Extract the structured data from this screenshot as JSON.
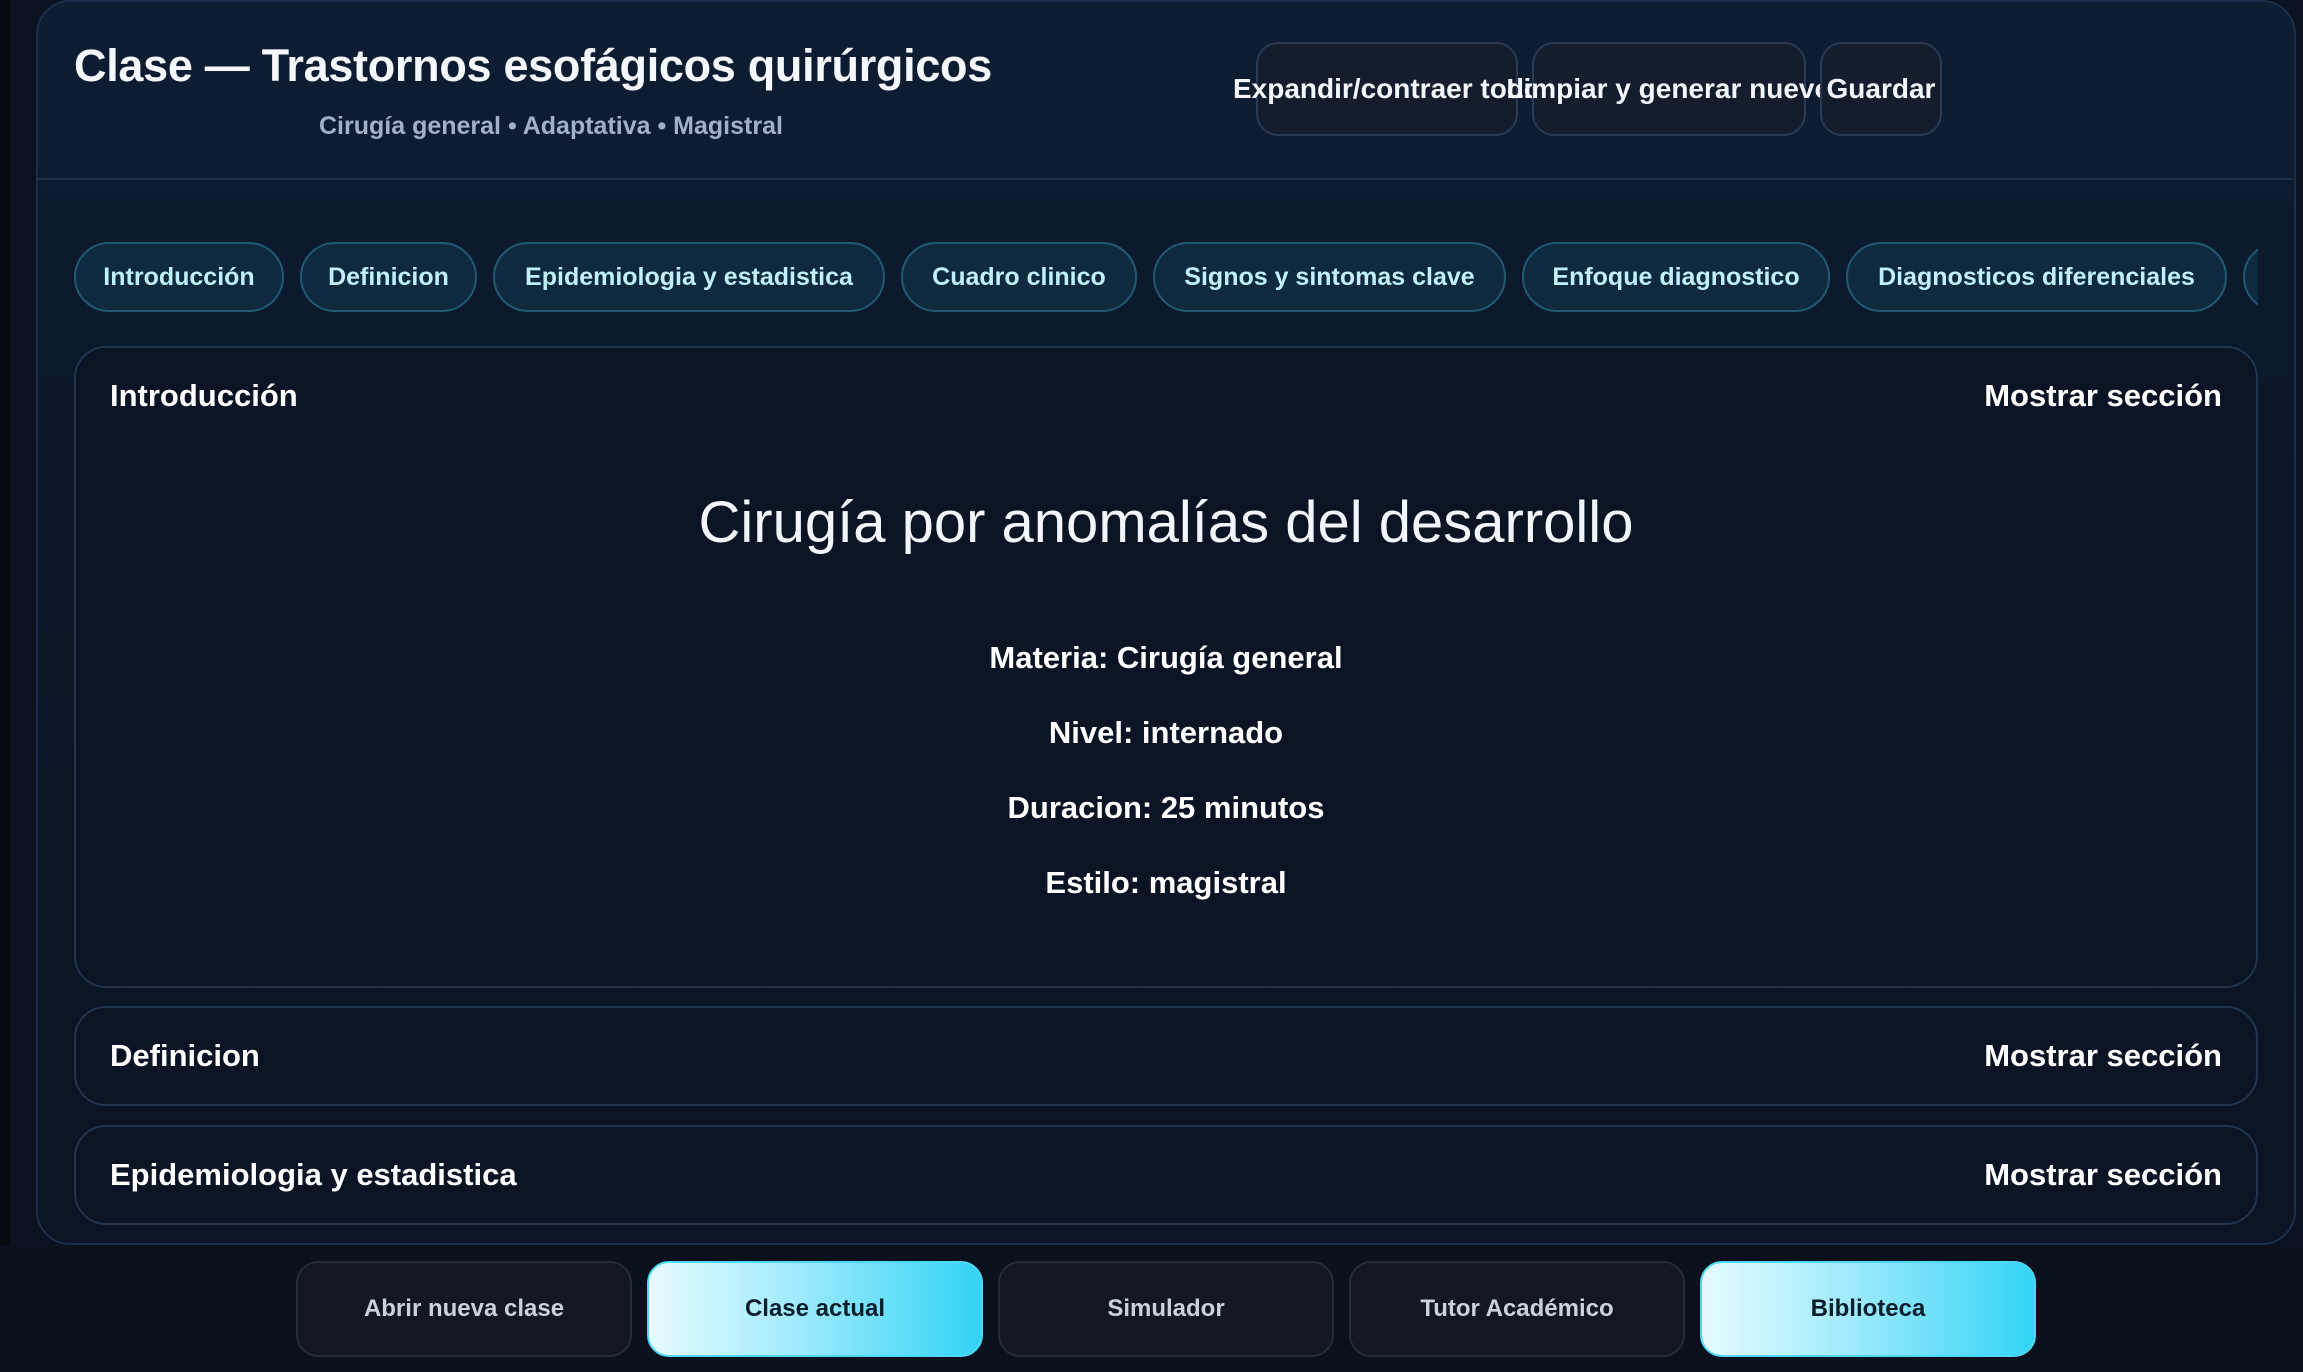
{
  "header": {
    "title": "Clase — Trastornos esofágicos quirúrgicos",
    "subtitle": "Cirugía general • Adaptativa • Magistral",
    "buttons": {
      "expand": "Expandir/contraer todo",
      "clear": "Limpiar y generar nuevo",
      "save": "Guardar"
    }
  },
  "tabs": [
    "Introducción",
    "Definicion",
    "Epidemiologia y estadistica",
    "Cuadro clinico",
    "Signos y sintomas clave",
    "Enfoque diagnostico",
    "Diagnosticos diferenciales"
  ],
  "sections": [
    {
      "title": "Introducción",
      "toggle": "Mostrar sección"
    },
    {
      "title": "Definicion",
      "toggle": "Mostrar sección"
    },
    {
      "title": "Epidemiologia y estadistica",
      "toggle": "Mostrar sección"
    }
  ],
  "intro": {
    "heading": "Cirugía por anomalías del desarrollo",
    "materia": "Materia: Cirugía general",
    "nivel": "Nivel: internado",
    "duracion": "Duracion: 25 minutos",
    "estilo": "Estilo: magistral"
  },
  "bottom_nav": [
    {
      "label": "Abrir nueva clase",
      "active": false
    },
    {
      "label": "Clase actual",
      "active": true
    },
    {
      "label": "Simulador",
      "active": false
    },
    {
      "label": "Tutor Académico",
      "active": false
    },
    {
      "label": "Biblioteca",
      "active": true
    }
  ],
  "colors": {
    "background": "#0a1120",
    "tab_text": "#bff0fb",
    "accent": "#32d3f5"
  }
}
